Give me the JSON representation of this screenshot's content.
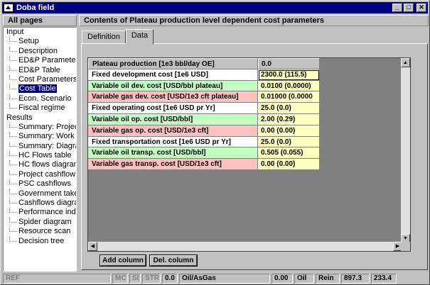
{
  "window": {
    "title": "Doba field",
    "minimize": "_",
    "maximize": "□",
    "close": "✕"
  },
  "left_panel": {
    "header": "All pages",
    "groups": [
      {
        "label": "Input",
        "items": [
          "Setup",
          "Description",
          "ED&P Parameters",
          "ED&P Table",
          "Cost Parameters",
          "Cost Table",
          "Econ. Scenario",
          "Fiscal regime"
        ],
        "selected": "Cost Table"
      },
      {
        "label": "Results",
        "items": [
          "Summary: Project",
          "Summary: Work",
          "Summary: Diagram",
          "HC Flows table",
          "HC flows diagram",
          "Project cashflow",
          "PSC cashflows",
          "Government take",
          "Cashflows diagram",
          "Performance ind.",
          "Spider diagram",
          "Resource scan",
          "Decision tree"
        ]
      }
    ]
  },
  "right_panel": {
    "header": "Contents of Plateau production level dependent cost parameters",
    "tabs": [
      "Definition",
      "Data"
    ],
    "active_tab": "Data"
  },
  "table": {
    "header": {
      "label": "Plateau production [1e3 bbl/day OE]",
      "value": "0.0"
    },
    "rows": [
      {
        "label": "Fixed development cost [1e6 USD]",
        "value": "2300.0 (115.5)",
        "color": "white"
      },
      {
        "label": "Variable oil dev. cost [USD/bbl plateau]",
        "value": "0.0100 (0.0000)",
        "color": "green"
      },
      {
        "label": "Variable gas dev. cost [USD/1e3 cft plateau]",
        "value": "0.01000 (0.0000",
        "color": "red"
      },
      {
        "label": "Fixed operating cost [1e6 USD pr Yr]",
        "value": "25.0 (0.0)",
        "color": "white"
      },
      {
        "label": "Variable oil op. cost [USD/bbl]",
        "value": "2.00 (0.29)",
        "color": "green"
      },
      {
        "label": "Variable gas op. cost [USD/1e3 cft]",
        "value": "0.00 (0.00)",
        "color": "red"
      },
      {
        "label": "Fixed transportation cost [1e6 USD pr Yr]",
        "value": "25.0 (0.0)",
        "color": "white"
      },
      {
        "label": "Variable oil transp. cost [USD/bbl]",
        "value": "0.505 (0.055)",
        "color": "green"
      },
      {
        "label": "Variable gas transp. cost [USD/1e3 cft]",
        "value": "0.00 (0.00)",
        "color": "red"
      }
    ]
  },
  "buttons": {
    "add_column": "Add column",
    "del_column": "Del. column"
  },
  "scroll": {
    "up": "▲",
    "down": "▼",
    "left": "◀",
    "right": "▶"
  },
  "status_bar": {
    "ref": "REF",
    "mc": "MC",
    "si": "SI",
    "str": "STR",
    "value1": "0.0",
    "unit1": "Oil/AsGas",
    "value2": "0.00",
    "unit2": "Oil",
    "rein": "Rein",
    "value3": "897.3",
    "value4": "233.4"
  }
}
